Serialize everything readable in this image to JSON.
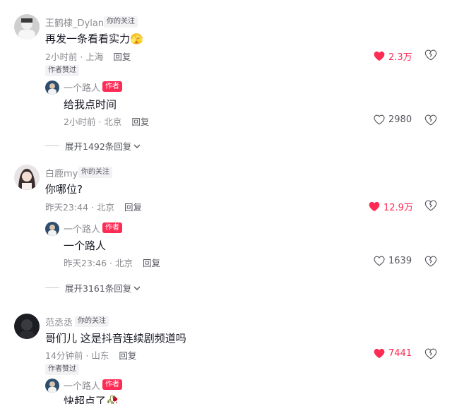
{
  "comments": [
    {
      "username": "王鹤棣_Dylan",
      "follow_tag": "你的关注",
      "text": "再发一条看看实力🫣",
      "meta_time": "2小时前 · 上海",
      "reply_label": "回复",
      "likes": "2.3万",
      "liked": true,
      "liked_by_author": "作者赞过",
      "reply": {
        "username": "一个路人",
        "author_tag": "作者",
        "text": "给我点时间",
        "meta_time": "2小时前 · 北京",
        "reply_label": "回复",
        "likes": "2980",
        "liked": false
      },
      "expand_label": "展开1492条回复"
    },
    {
      "username": "白鹿my",
      "follow_tag": "你的关注",
      "text": "你哪位?",
      "meta_time": "昨天23:44 · 北京",
      "reply_label": "回复",
      "likes": "12.9万",
      "liked": true,
      "reply": {
        "username": "一个路人",
        "author_tag": "作者",
        "text": "一个路人",
        "meta_time": "昨天23:46 · 北京",
        "reply_label": "回复",
        "likes": "1639",
        "liked": false
      },
      "expand_label": "展开3161条回复"
    },
    {
      "username": "范丞丞",
      "follow_tag": "你的关注",
      "text": "哥们儿 这是抖音连续剧频道吗",
      "meta_time": "14分钟前 · 山东",
      "reply_label": "回复",
      "likes": "7441",
      "liked": true,
      "liked_by_author": "作者赞过",
      "reply": {
        "username": "一个路人",
        "author_tag": "作者",
        "text": "快超点了🥀"
      }
    }
  ],
  "colors": {
    "accent_red": "#fe2c55",
    "secondary_text": "#8a8b91",
    "primary_text": "#161823"
  }
}
